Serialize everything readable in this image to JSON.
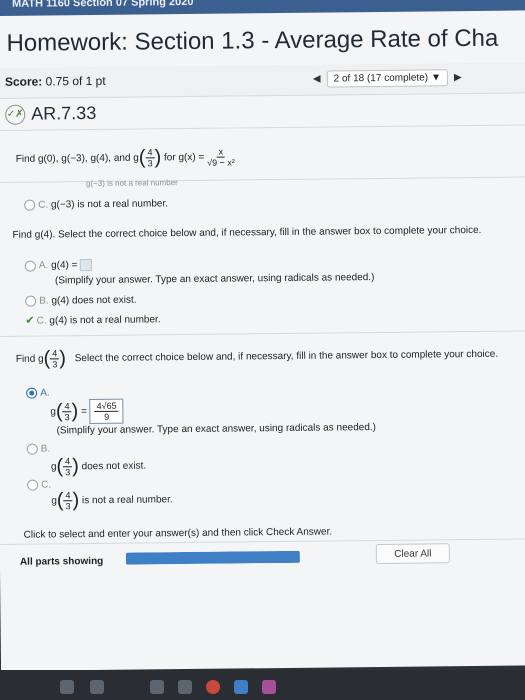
{
  "header": {
    "course": "MATH 1160 Section 07 Spring 2020",
    "title": "Homework: Section 1.3 - Average Rate of Cha"
  },
  "scorebar": {
    "score_label": "Score:",
    "score_value": "0.75 of 1 pt",
    "position": "2 of 18 (17 complete)",
    "prev_icon": "triangle-left",
    "next_icon": "triangle-right",
    "dropdown_icon": "triangle-down"
  },
  "question": {
    "id": "AR.7.33",
    "prompt_pre": "Find g(0), g(−3), g(4), and g",
    "prompt_frac": {
      "num": "4",
      "den": "3"
    },
    "prompt_post": "for g(x) =",
    "fn_num": "x",
    "fn_den": "√9 − x²"
  },
  "cut_line": "g(−3) is not a real number",
  "part_c_prev": {
    "letter": "C.",
    "text": "g(−3) is not a real number."
  },
  "part_g4": {
    "instruction": "Find g(4). Select the correct choice below and, if necessary, fill in the answer box to complete your choice.",
    "a_letter": "A.",
    "a_text": "g(4) =",
    "a_hint": "(Simplify your answer. Type an exact answer, using radicals as needed.)",
    "b_letter": "B.",
    "b_text": "g(4) does not exist.",
    "c_letter": "C.",
    "c_text": "g(4) is not a real number."
  },
  "part_g43": {
    "find": "Find g",
    "frac": {
      "num": "4",
      "den": "3"
    },
    "instruction": "Select the correct choice below and, if necessary, fill in the answer box to complete your choice.",
    "a_letter": "A.",
    "a_g": "g",
    "a_eq": "=",
    "answer_num": "4√65",
    "answer_den": "9",
    "a_hint": "(Simplify your answer. Type an exact answer, using radicals as needed.)",
    "b_letter": "B.",
    "b_text": "does not exist.",
    "c_letter": "C.",
    "c_text": "is not a real number."
  },
  "footer": {
    "instruction": "Click to select and enter your answer(s) and then click Check Answer.",
    "all_parts": "All parts showing",
    "progress_fraction": 1.0,
    "clear_all": "Clear All"
  },
  "colors": {
    "accent": "#2f6fb7",
    "header_strip": "#3b5f8f",
    "check": "#3a8a2e"
  }
}
